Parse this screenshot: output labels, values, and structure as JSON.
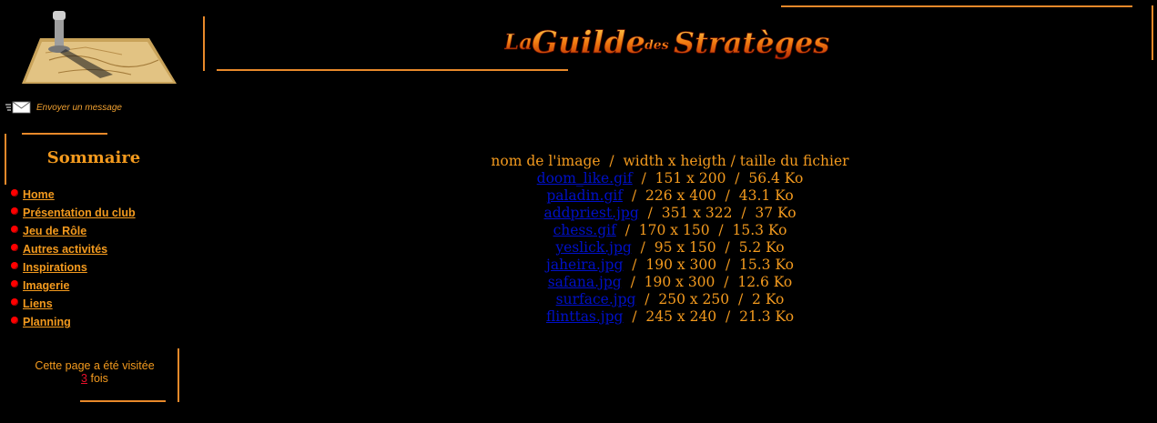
{
  "header": {
    "logo_icon": "chess-piece-on-map-icon",
    "title_image_text": "La Guilde des Stratèges"
  },
  "sidebar": {
    "message_link": "Envoyer un message",
    "message_icon": "envelope-icon",
    "sommaire_title": "Sommaire",
    "nav": [
      {
        "label": "Home"
      },
      {
        "label": "Présentation du club"
      },
      {
        "label": "Jeu de Rôle"
      },
      {
        "label": "Autres activités"
      },
      {
        "label": "Inspirations"
      },
      {
        "label": "Imagerie"
      },
      {
        "label": "Liens"
      },
      {
        "label": "Planning"
      }
    ],
    "visits": {
      "prefix": "Cette page a été visitée",
      "count": "3",
      "suffix": "fois"
    }
  },
  "main": {
    "heading": "nom de l'image  /  width x heigth / taille du fichier",
    "files": [
      {
        "name": "doom_like.gif",
        "details": "/  151 x 200  /  56.4 Ko"
      },
      {
        "name": "paladin.gif",
        "details": "/  226 x 400  /  43.1 Ko"
      },
      {
        "name": "addpriest.jpg",
        "details": "/  351 x 322  /  37 Ko"
      },
      {
        "name": "chess.gif",
        "details": "/  170 x 150  /  15.3 Ko"
      },
      {
        "name": "yeslick.jpg",
        "details": "/  95 x 150  /  5.2 Ko"
      },
      {
        "name": "jaheira.jpg",
        "details": "/  190 x 300  /  15.3 Ko"
      },
      {
        "name": "safana.jpg",
        "details": "/  190 x 300  /  12.6 Ko"
      },
      {
        "name": "surface.jpg",
        "details": "/  250 x 250  /  2 Ko"
      },
      {
        "name": "flinttas.jpg",
        "details": "/  245 x 240  /  21.3 Ko"
      }
    ]
  },
  "colors": {
    "background": "#000000",
    "accent_orange": "#f39a1e",
    "link_blue": "#0010c8",
    "bullet_red": "#ff0000"
  }
}
